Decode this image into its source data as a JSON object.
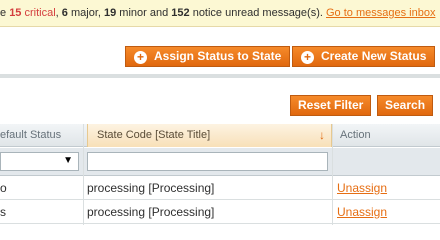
{
  "notice": {
    "prefix": "e ",
    "critical_count": "15",
    "critical_label": " critical",
    "sep1": ", ",
    "major_count": "6",
    "major_label": " major, ",
    "minor_count": "19",
    "minor_label": " minor and ",
    "notice_count": "152",
    "notice_label": " notice unread message(s).",
    "link_label": "Go to messages inbox"
  },
  "toolbar": {
    "assign_label": "Assign Status to State",
    "create_label": "Create New Status"
  },
  "grid_actions": {
    "reset_label": "Reset Filter",
    "search_label": "Search"
  },
  "grid": {
    "columns": {
      "default_status": "efault Status",
      "state_code": "State Code [State Title]",
      "action": "Action"
    },
    "filter": {
      "default_status_value": "",
      "state_code_value": ""
    },
    "rows": [
      {
        "default_status": "o",
        "state_code": "processing [Processing]",
        "action": "Unassign"
      },
      {
        "default_status": "s",
        "state_code": "processing [Processing]",
        "action": "Unassign"
      }
    ]
  },
  "colors": {
    "accent": "#e66e13",
    "button_top": "#f68a2a",
    "button_bottom": "#e0680e",
    "critical": "#d43e3e",
    "notice_bg": "#fcf8d3"
  },
  "icons": {
    "plus": "plus-circle-icon",
    "sort": "sort-down-arrow-icon",
    "dropdown": "dropdown-arrow-icon"
  }
}
